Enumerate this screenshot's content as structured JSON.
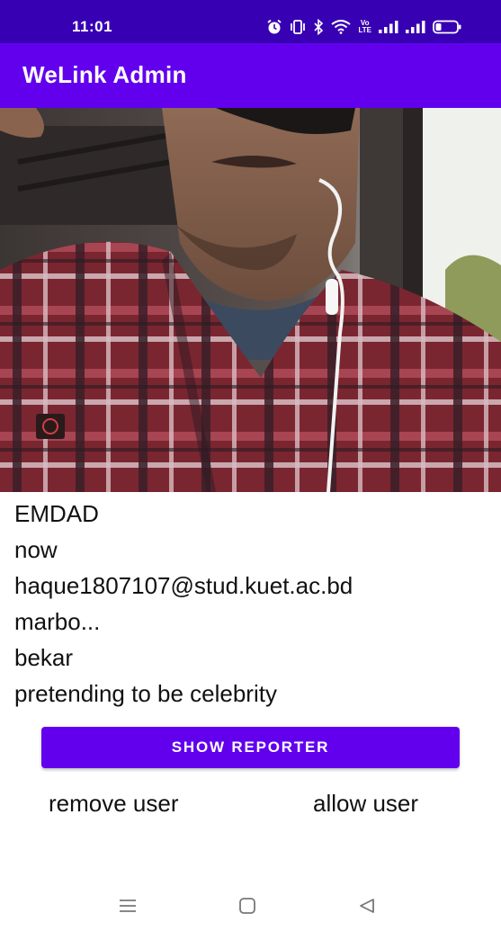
{
  "status_bar": {
    "time": "11:01",
    "icons": [
      "alarm-icon",
      "vibrate-icon",
      "bluetooth-icon",
      "wifi-icon",
      "volte-icon",
      "signal-icon",
      "signal-icon",
      "battery-icon"
    ],
    "volte_text_top": "Vo",
    "volte_text_bottom": "LTE"
  },
  "app_bar": {
    "title": "WeLink Admin"
  },
  "profile": {
    "image": "profile-photo",
    "name": "EMDAD",
    "last_seen": "now",
    "email": "haque1807107@stud.kuet.ac.bd",
    "status": "marbo...",
    "occupation": "bekar",
    "report_reason": "pretending to be celebrity"
  },
  "actions": {
    "show_reporter": "SHOW REPORTER",
    "remove_user": "remove user",
    "allow_user": "allow user"
  },
  "navigation": [
    "menu-icon",
    "home-icon",
    "back-icon"
  ],
  "colors": {
    "status_bar": "#3700b3",
    "primary": "#6200ee",
    "text": "#111111"
  }
}
